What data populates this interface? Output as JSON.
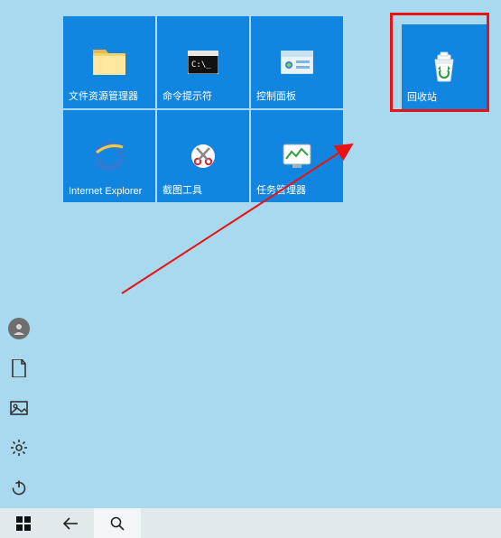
{
  "tiles": [
    {
      "label": "文件资源管理器",
      "icon": "folder"
    },
    {
      "label": "命令提示符",
      "icon": "cmd"
    },
    {
      "label": "控制面板",
      "icon": "control-panel"
    },
    {
      "label": "Internet Explorer",
      "icon": "ie"
    },
    {
      "label": "截图工具",
      "icon": "snip"
    },
    {
      "label": "任务管理器",
      "icon": "taskmgr"
    }
  ],
  "highlighted_tile": {
    "label": "回收站",
    "icon": "recycle-bin"
  },
  "annotation": {
    "highlight_color": "#e81414",
    "arrow_color": "#e81414"
  },
  "taskbar": {
    "start": "开始",
    "back": "返回",
    "search": "搜索"
  }
}
